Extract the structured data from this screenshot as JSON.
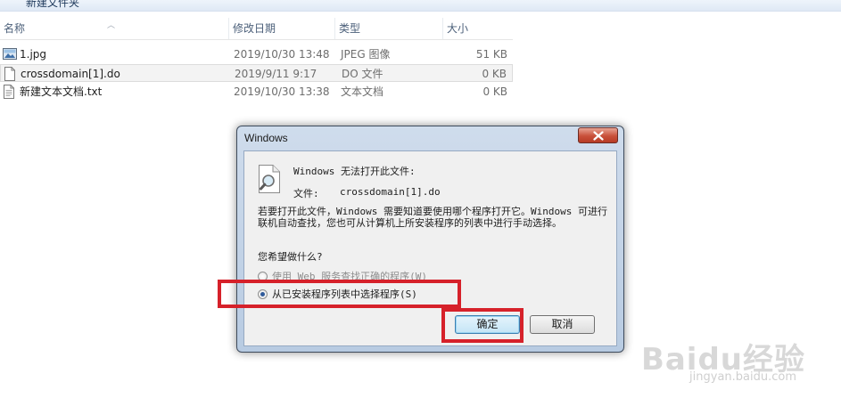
{
  "explorer": {
    "toolbar_label": "新建文件夹",
    "columns": {
      "name": "名称",
      "date": "修改日期",
      "type": "类型",
      "size": "大小"
    },
    "files": [
      {
        "name": "1.jpg",
        "date": "2019/10/30 13:48",
        "type": "JPEG 图像",
        "size": "51 KB",
        "icon": "image-file-icon"
      },
      {
        "name": "crossdomain[1].do",
        "date": "2019/9/11 9:17",
        "type": "DO 文件",
        "size": "0 KB",
        "icon": "generic-file-icon"
      },
      {
        "name": "新建文本文档.txt",
        "date": "2019/10/30 13:38",
        "type": "文本文档",
        "size": "0 KB",
        "icon": "text-file-icon"
      }
    ]
  },
  "dialog": {
    "title": "Windows",
    "message": "Windows 无法打开此文件:",
    "file_label": "文件:",
    "file_name": "crossdomain[1].do",
    "paragraph": "若要打开此文件，Windows 需要知道要使用哪个程序打开它。Windows 可进行联机自动查找，您也可从计算机上所安装程序的列表中进行手动选择。",
    "question": "您希望做什么?",
    "options": [
      {
        "label": "使用 Web 服务查找正确的程序(W)",
        "checked": false
      },
      {
        "label": "从已安装程序列表中选择程序(S)",
        "checked": true
      }
    ],
    "ok_label": "确定",
    "cancel_label": "取消"
  },
  "watermark": {
    "logo": "Baidu经验",
    "url": "jingyan.baidu.com"
  },
  "colors": {
    "highlight_box": "#d6212a",
    "dialog_frame": "#b8cbe2",
    "close_button": "#c9503a"
  }
}
